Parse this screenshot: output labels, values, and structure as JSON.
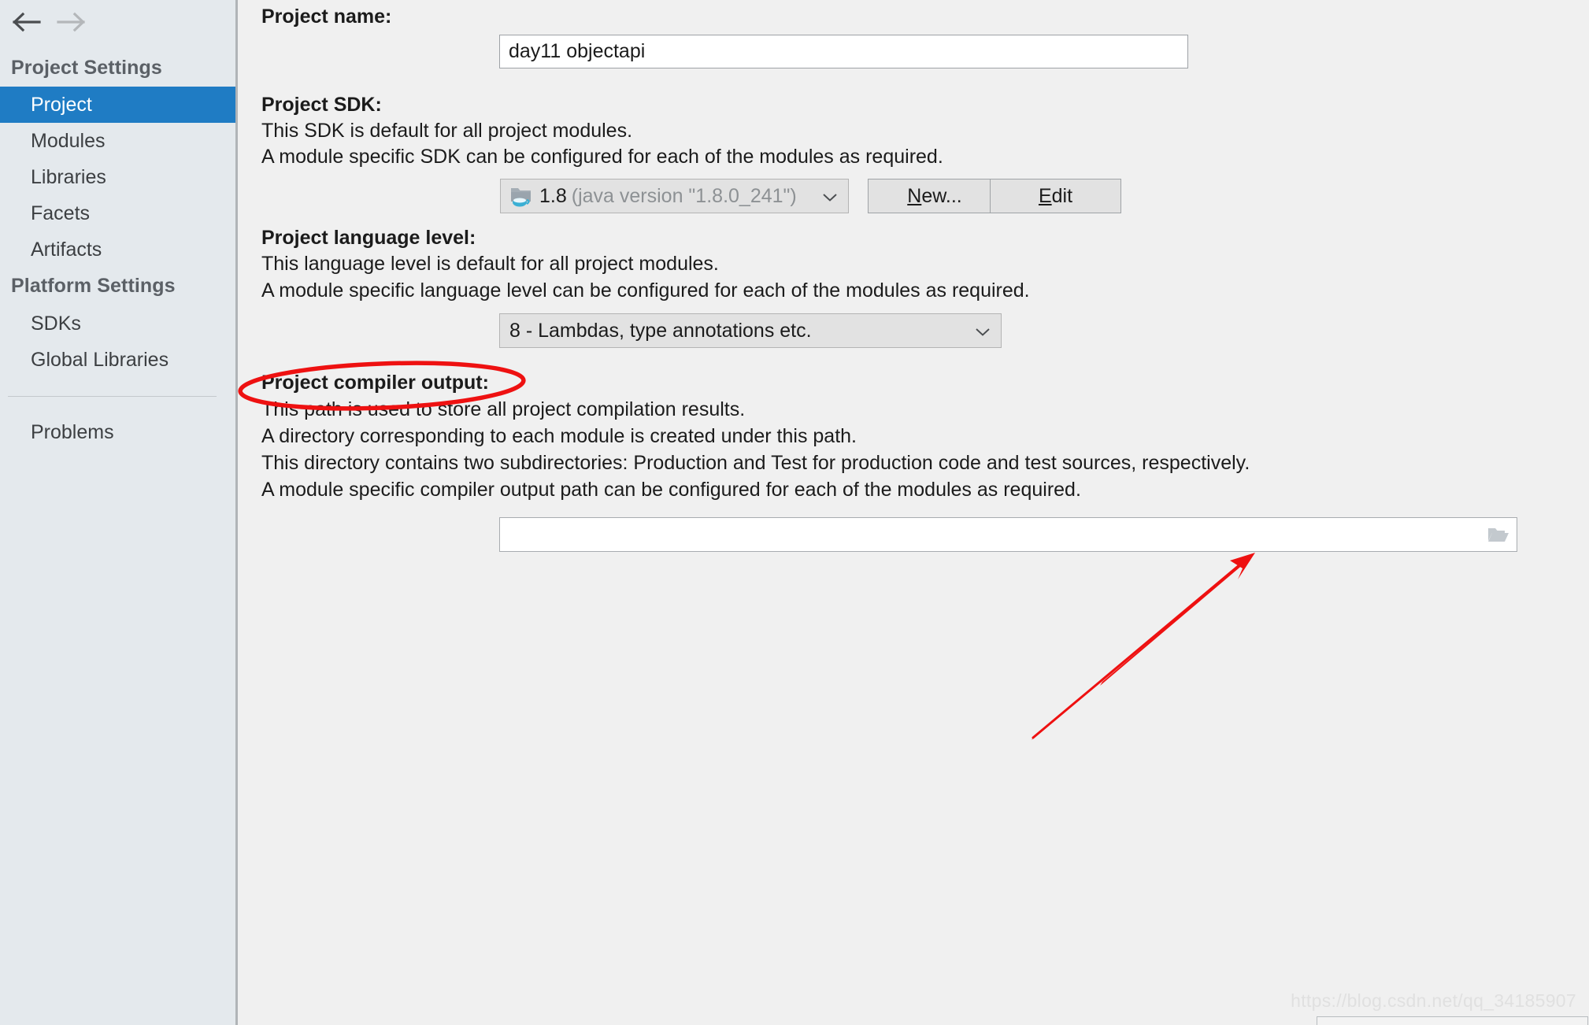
{
  "window": {
    "background_color": "#f0f0f0",
    "accent_color": "#1f7cc4"
  },
  "sidebar": {
    "background_color": "#e4e9ed",
    "nav": {
      "back_label": "Back",
      "back_icon": "arrow-left-icon",
      "forward_label": "Forward",
      "forward_icon": "arrow-right-icon"
    },
    "groups": [
      {
        "title": "Project Settings"
      },
      {
        "title": "Platform Settings"
      }
    ],
    "project_settings_items": [
      {
        "label": "Project",
        "selected": true
      },
      {
        "label": "Modules",
        "selected": false
      },
      {
        "label": "Libraries",
        "selected": false
      },
      {
        "label": "Facets",
        "selected": false
      },
      {
        "label": "Artifacts",
        "selected": false
      }
    ],
    "platform_settings_items": [
      {
        "label": "SDKs",
        "selected": false
      },
      {
        "label": "Global Libraries",
        "selected": false
      }
    ],
    "other_items": [
      {
        "label": "Problems",
        "selected": false
      }
    ]
  },
  "main": {
    "project_name": {
      "label": "Project name:",
      "value": "day11 objectapi",
      "placeholder": ""
    },
    "project_sdk": {
      "label": "Project SDK:",
      "desc_lines": [
        "This SDK is default for all project modules.",
        "A module specific SDK can be configured for each of the modules as required."
      ],
      "combo": {
        "icon": "java-sdk-folder-icon",
        "name": "1.8",
        "version": "(java version \"1.8.0_241\")",
        "caret_icon": "chevron-down-icon"
      },
      "new_button": {
        "label": "New...",
        "mnemonic": "N",
        "rest": "ew..."
      },
      "edit_button": {
        "label": "Edit",
        "mnemonic": "E",
        "rest": "dit"
      }
    },
    "language_level": {
      "label": "Project language level:",
      "desc_lines": [
        "This language level is default for all project modules.",
        "A module specific language level can be configured for each of the modules as required."
      ],
      "selected": "8 - Lambdas, type annotations etc.",
      "caret_icon": "chevron-down-icon"
    },
    "compiler_output": {
      "label": "Project compiler output:",
      "desc_lines": [
        "This path is used to store all project compilation results.",
        "A directory corresponding to each module is created under this path.",
        "This directory contains two subdirectories: Production and Test for production code and test sources, respectively.",
        "A module specific compiler output path can be configured for each of the modules as required."
      ],
      "value": "",
      "placeholder": "",
      "browse_icon": "folder-open-icon"
    }
  },
  "annotations": {
    "color": "#ee1111",
    "ellipse": {
      "target": "Project compiler output:",
      "shape": "hand-drawn-ellipse"
    },
    "arrow": {
      "target": "folder-open-icon",
      "shape": "hand-drawn-arrow",
      "direction": "up-right"
    }
  },
  "watermark": {
    "text": "https://blog.csdn.net/qq_34185907"
  }
}
